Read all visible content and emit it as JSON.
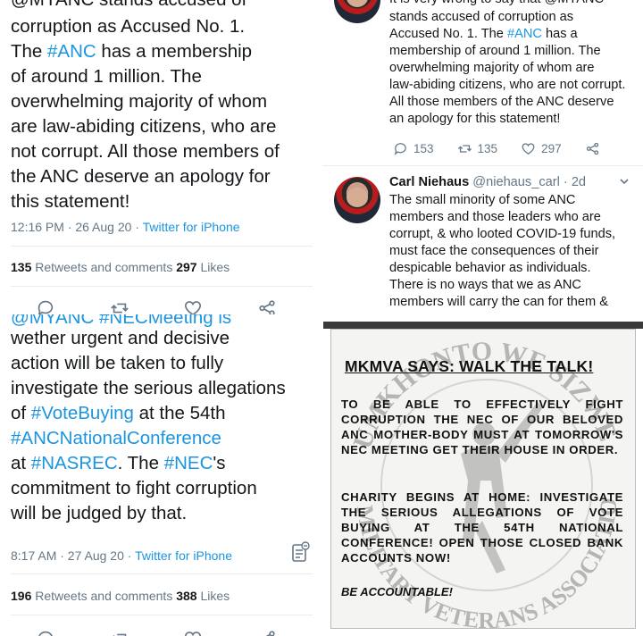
{
  "tweet1": {
    "partial_top": "@MYANC stands accused of",
    "line1": "corruption as Accused No. 1.",
    "line2_pre": "The ",
    "line2_tag": "#ANC",
    "line2_post": " has a membership",
    "line3": "of around 1 million. The",
    "line4": "overwhelming majority of whom",
    "line5": "are law-abiding citizens, who are",
    "line6": "not corrupt. All those members of",
    "line7": "the ANC deserve an apology for",
    "line8": "this statement!",
    "time": "12:16 PM · 26 Aug 20 · ",
    "source": "Twitter for iPhone",
    "retweets_count": "135",
    "retweets_label": " Retweets and comments ",
    "likes_count": "297",
    "likes_label": " Likes"
  },
  "tweet2": {
    "partial_top": "@MYANC #NECMeeting is",
    "line1": "wether urgent and decisive",
    "line2": "action will be taken to fully",
    "line3": "investigate the serious allegations",
    "line4_pre": "of ",
    "line4_tag": "#VoteBuying",
    "line4_post": " at the 54th",
    "line5_tag": "#ANCNationalConference",
    "line6_pre": "at ",
    "line6_tag1": "#NASREC",
    "line6_mid": ". The ",
    "line6_tag2": "#NEC",
    "line6_post": "'s",
    "line7": "commitment to fight corruption",
    "line8": "will be judged by that.",
    "time": "8:17 AM · 27 Aug 20 · ",
    "source": "Twitter for iPhone",
    "retweets_count": "196",
    "retweets_label": " Retweets and comments ",
    "likes_count": "388",
    "likes_label": " Likes"
  },
  "tweet3": {
    "partial_top": "It is very wrong to say that @MYANC",
    "l1": "stands accused of corruption as",
    "l2_pre": "Accused No. 1. The ",
    "l2_tag": "#ANC",
    "l2_post": " has a",
    "l3": "membership of around 1 million. The",
    "l4": "overwhelming majority of whom are",
    "l5": "law-abiding citizens, who are not corrupt.",
    "l6": "All those members of the ANC deserve",
    "l7": "an apology for this statement!",
    "replies": "153",
    "retweets": "135",
    "likes": "297"
  },
  "tweet4": {
    "name": "Carl Niehaus",
    "handle": "@niehaus_carl · 2d",
    "l1": "The small minority of some ANC",
    "l2": "members and those leaders who are",
    "l3": "corrupt, & who looted COVID-19 funds,",
    "l4": "must face the consequences of their",
    "l5": "despicable behavior as individuals.",
    "l6": "There is no ways that we as ANC",
    "l7": "members will carry the can for them &"
  },
  "poster": {
    "title": "MKMVA SAYS: WALK THE TALK!",
    "para1": "To be able to effectively fight corruption the NEC of our beloved ANC mother-body must at tomorrow's NEC meeting get their house in order.",
    "para2": "Charity begins at home: investigate the serious allegations of vote buying at the 54th National Conference! Open those closed bank accounts now!",
    "footer": "BE ACCOUNTABLE!",
    "watermark_top": "UMKHONTO WE SIZWE",
    "watermark_bottom": "MILITARY VETERANS ASSOCIATION"
  },
  "colors": {
    "link": "#1b95e0",
    "muted": "#657786",
    "text": "#14171a"
  },
  "icons": [
    "reply-icon",
    "retweet-icon",
    "like-icon",
    "share-icon",
    "chevron-down-icon",
    "document-icon"
  ]
}
